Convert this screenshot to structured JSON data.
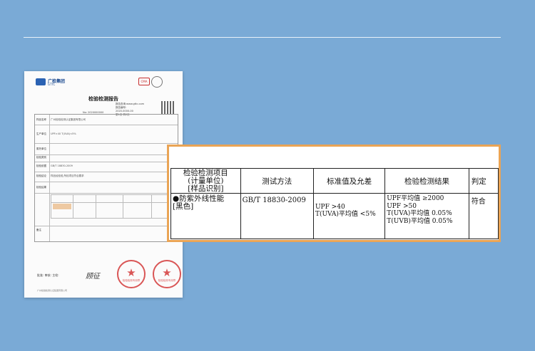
{
  "report": {
    "logo_name": "广检集团",
    "logo_sub": "GTTC",
    "org_small": "广州检验检测认证集团有限公司",
    "cert_mark": "CMA",
    "title": "检验检测报告",
    "meta_lines": [
      "报告查询:www.gttc.com",
      "报告编号:",
      "2020-0000-00",
      "第1页 共2页"
    ],
    "report_no": "No: 2020000000",
    "table_labels": [
      "样品名称",
      "生产单位",
      "委托单位",
      "检验类别",
      "检验依据",
      "检验结论",
      "检验结果",
      "备注"
    ],
    "table_texts": [
      "广州检验检测认证集团有限公司",
      "UPF>40 T(UVA)<5%",
      "GB/T 18830-2009",
      "样品经检验,所检项目符合要求"
    ],
    "signature_label": "批准: 审核: 主检:",
    "signature_scribble": "顾征",
    "footer": "广州检验检测认证集团有限公司",
    "stamp_text": "检验检测专用章"
  },
  "zoom_table": {
    "headers": [
      "检验检测项目\n(计量单位)\n[样品识别]",
      "测试方法",
      "标准值及允差",
      "检验检测结果",
      "判定"
    ],
    "row": {
      "item_line1": "●防紫外线性能",
      "item_line2": "[黑色]",
      "method": "GB/T 18830-2009",
      "standard_line1": "UPF >40",
      "standard_line2": "T(UVA)平均值 <5%",
      "result_lines": [
        "UPF平均值 ≥2000",
        "UPF >50",
        "T(UVA)平均值 0.05%",
        "T(UVB)平均值 0.05%"
      ],
      "verdict": "符合"
    }
  },
  "colors": {
    "background": "#7aaad6",
    "zoom_border": "#eaa455",
    "stamp": "#d43a3a"
  }
}
